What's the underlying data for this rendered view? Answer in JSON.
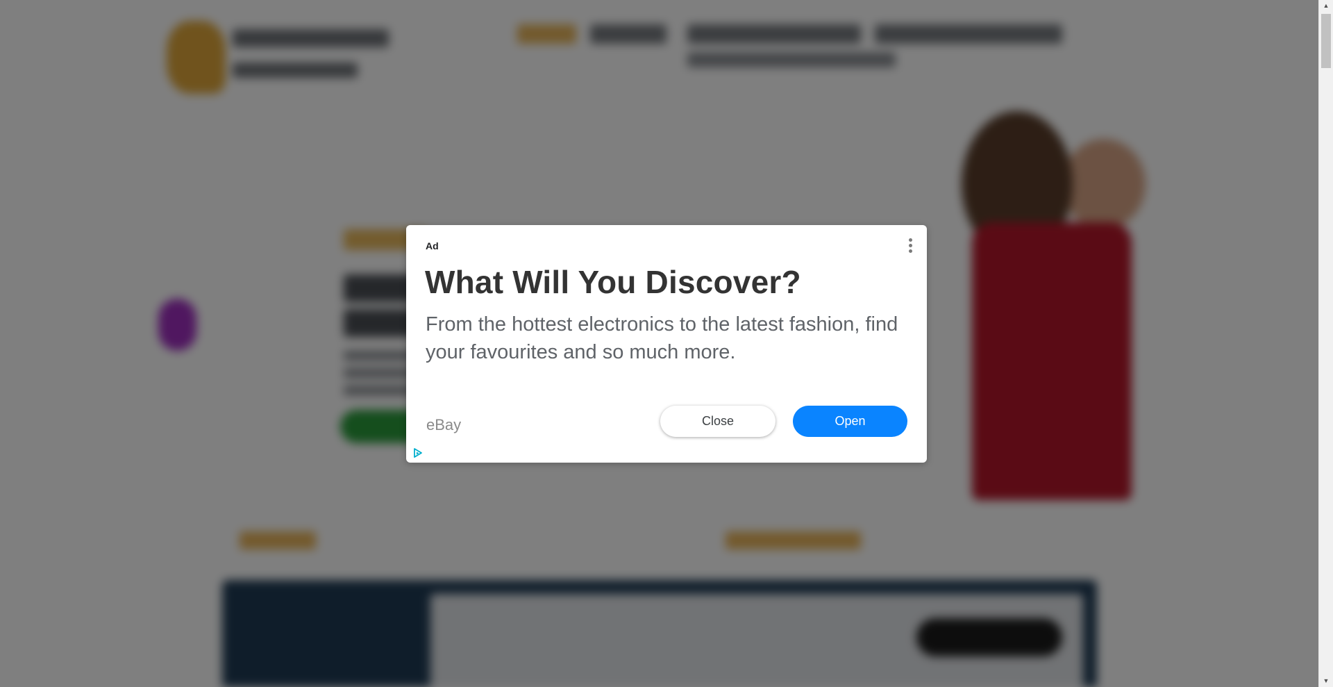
{
  "ad": {
    "label": "Ad",
    "title": "What Will You Discover?",
    "body": "From the hottest electronics to the latest fashion, find your favourites and so much more.",
    "advertiser": "eBay",
    "close_label": "Close",
    "open_label": "Open",
    "more_icon": "more-vert-icon",
    "adchoices_icon": "adchoices-icon"
  },
  "colors": {
    "open_button": "#0a84ff",
    "overlay": "rgba(0,0,0,0.5)",
    "adchoices": "#00aecd"
  },
  "scrollbar": {
    "up_icon": "arrow-up-icon",
    "down_icon": "arrow-down-icon"
  }
}
